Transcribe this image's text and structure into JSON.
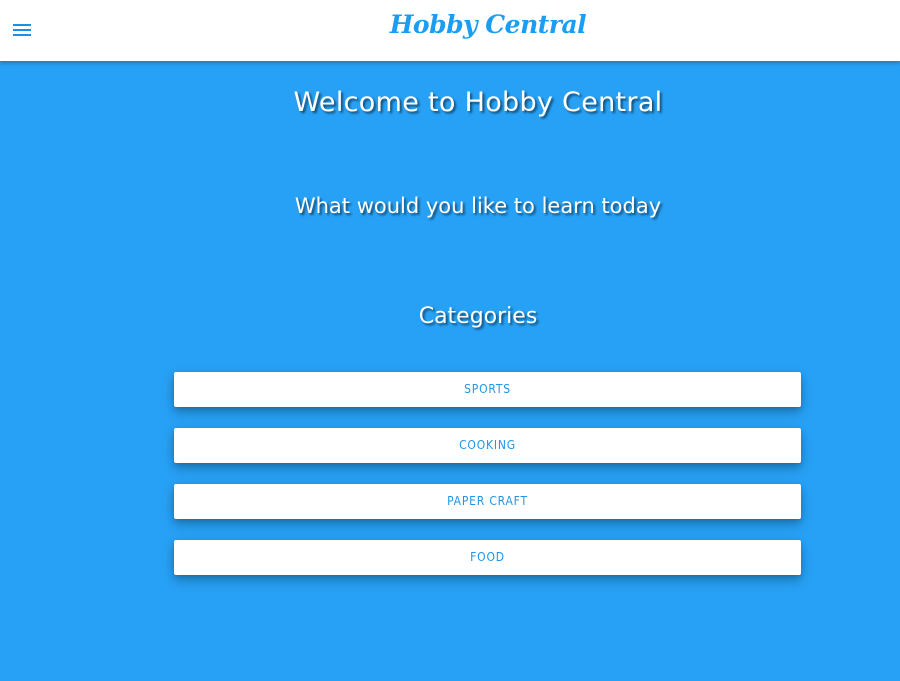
{
  "header": {
    "brand": "Hobby Central",
    "menu_icon": "hamburger-menu-icon"
  },
  "main": {
    "welcome": "Welcome to Hobby Central",
    "question": "What would you like to learn today",
    "categories_title": "Categories",
    "categories": [
      {
        "label": "SPORTS"
      },
      {
        "label": "COOKING"
      },
      {
        "label": "PAPER CRAFT"
      },
      {
        "label": "FOOD"
      }
    ]
  },
  "colors": {
    "accent": "#1c9df4",
    "background": "#27a1f6",
    "surface": "#ffffff"
  }
}
